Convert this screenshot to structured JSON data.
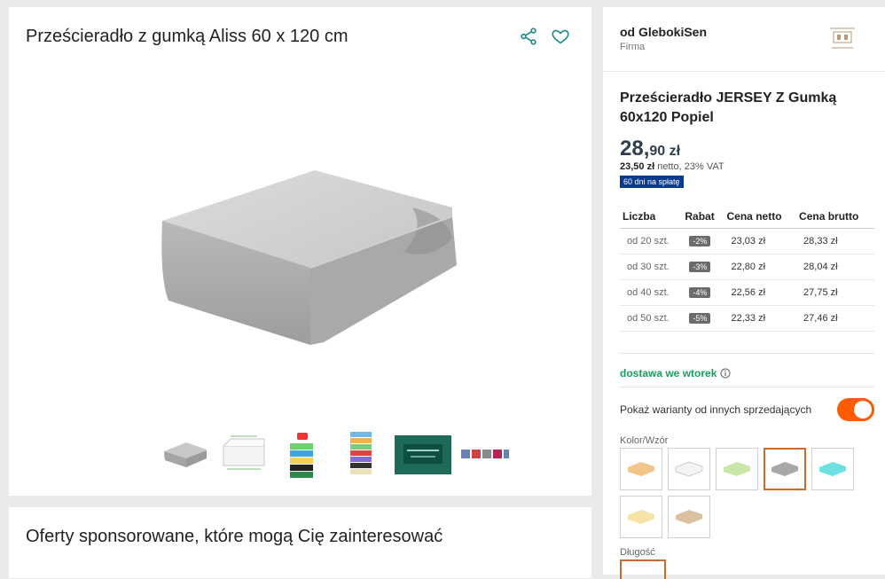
{
  "product": {
    "title": "Prześcieradło z gumką Aliss 60 x 120 cm"
  },
  "sponsored": {
    "title": "Oferty sponsorowane, które mogą Cię zainteresować"
  },
  "seller": {
    "name": "od GlebokiSen",
    "type": "Firma"
  },
  "offer": {
    "name": "Prześcieradło JERSEY Z Gumką 60x120 Popiel",
    "price_main": "28,",
    "price_rest": "90 zł",
    "netto_value": "23,50 zł",
    "netto_text": " netto, 23% VAT",
    "installment": "60 dni na spłatę",
    "delivery": "dostawa we wtorek"
  },
  "tiers": {
    "headers": [
      "Liczba",
      "Rabat",
      "Cena netto",
      "Cena brutto"
    ],
    "rows": [
      {
        "qty": "od 20 szt.",
        "discount": "-2%",
        "netto": "23,03 zł",
        "brutto": "28,33 zł"
      },
      {
        "qty": "od 30 szt.",
        "discount": "-3%",
        "netto": "22,80 zł",
        "brutto": "28,04 zł"
      },
      {
        "qty": "od 40 szt.",
        "discount": "-4%",
        "netto": "22,56 zł",
        "brutto": "27,75 zł"
      },
      {
        "qty": "od 50 szt.",
        "discount": "-5%",
        "netto": "22,33 zł",
        "brutto": "27,46 zł"
      }
    ]
  },
  "variants": {
    "toggle_label": "Pokaż warianty od innych sprzedających",
    "toggle_on": true,
    "color_label": "Kolor/Wzór",
    "length_label": "Długość",
    "colors": [
      "#f2c58b",
      "#f4f4f4",
      "#c9e8a8",
      "#a8a8a8",
      "#6fe0e0",
      "#f7e3a8",
      "#dcc1a0"
    ]
  },
  "colors": {
    "accent": "#ff5a00",
    "delivery": "#1a9e5c",
    "installment_bg": "#0b3b8c",
    "selected_border": "#c76b2f"
  }
}
